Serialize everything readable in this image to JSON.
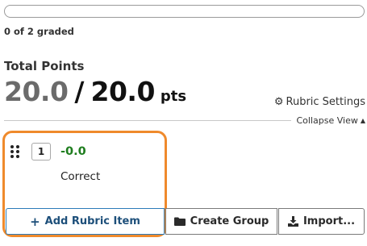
{
  "grading_progress": {
    "graded_text": "0 of 2 graded",
    "fraction": 0.0
  },
  "total_points": {
    "label": "Total Points",
    "current": "20.0",
    "separator": "/",
    "max": "20.0",
    "unit": "pts"
  },
  "toolbar": {
    "rubric_settings_label": "Rubric Settings",
    "rubric_settings_icon": "gear-icon",
    "collapse_view_label": "Collapse View",
    "collapse_view_icon": "caret-up-icon"
  },
  "rubric_items": [
    {
      "key": "1",
      "points": "-0.0",
      "description": "Correct",
      "points_color": "#1e7d1e"
    }
  ],
  "highlight_color": "#ef8a2c",
  "buttons": {
    "add_rubric_item": "Add Rubric Item",
    "add_icon": "plus-icon",
    "create_group": "Create Group",
    "create_group_icon": "folder-icon",
    "import": "Import...",
    "import_icon": "download-icon"
  }
}
